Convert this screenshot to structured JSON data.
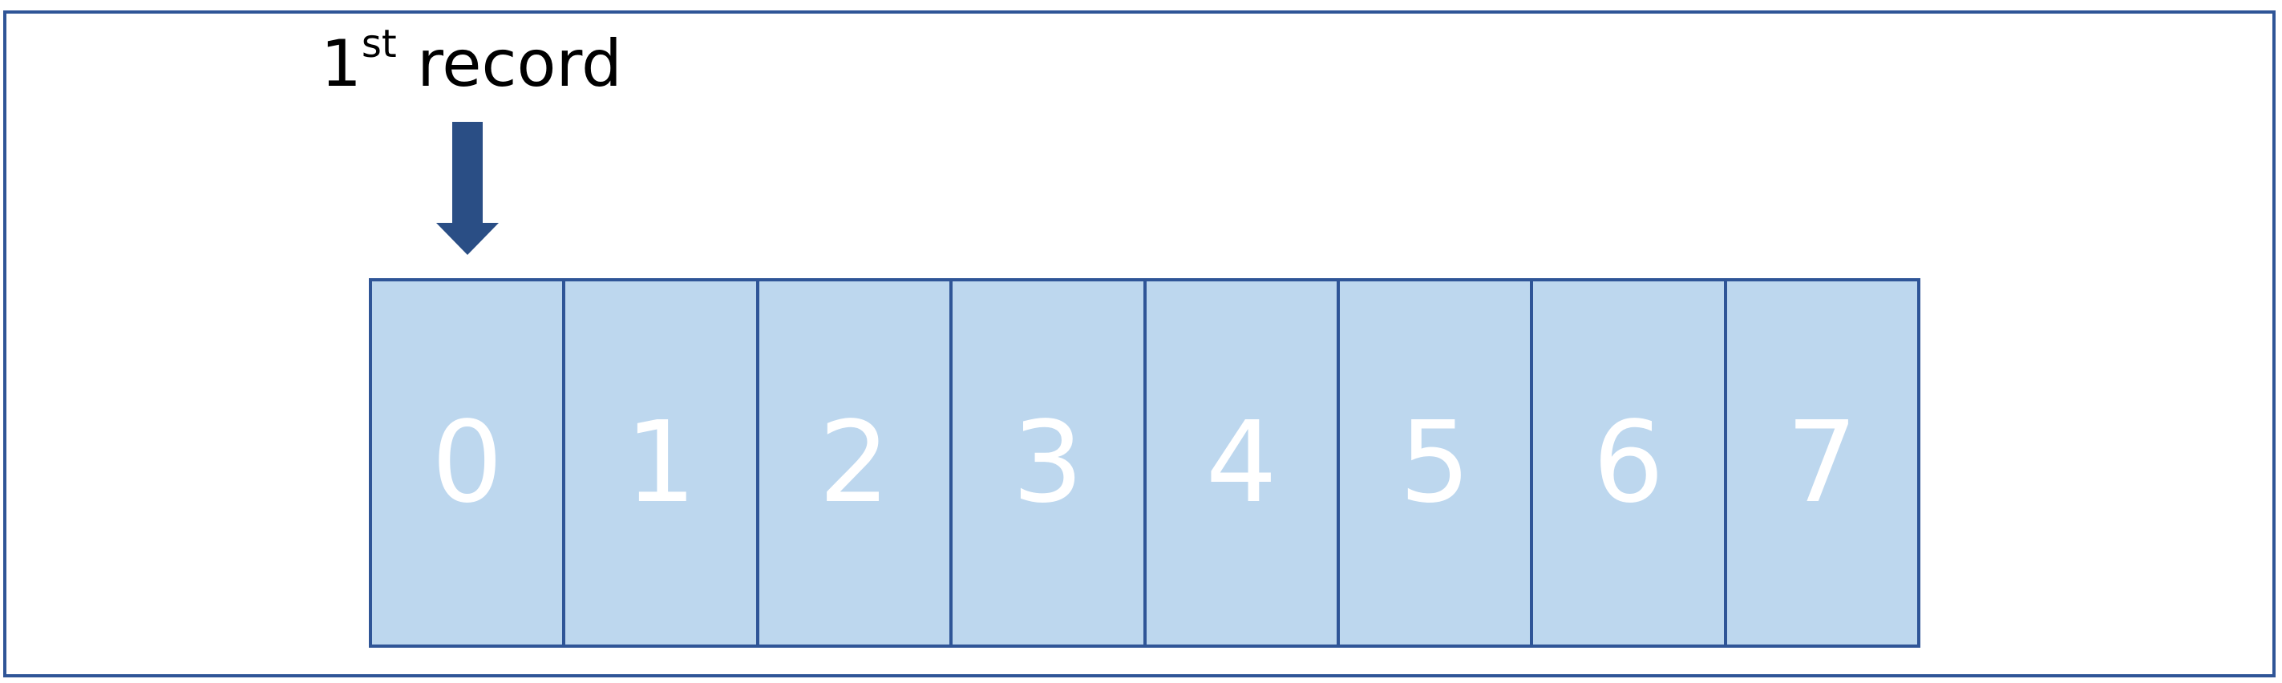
{
  "pointer": {
    "ordinal_number": "1",
    "ordinal_suffix": "st",
    "label_text": "record"
  },
  "cells": [
    "0",
    "1",
    "2",
    "3",
    "4",
    "5",
    "6",
    "7"
  ],
  "colors": {
    "border": "#2f5597",
    "cell_fill": "#bdd7ee",
    "cell_text": "#ffffff",
    "arrow": "#2a4e85"
  }
}
